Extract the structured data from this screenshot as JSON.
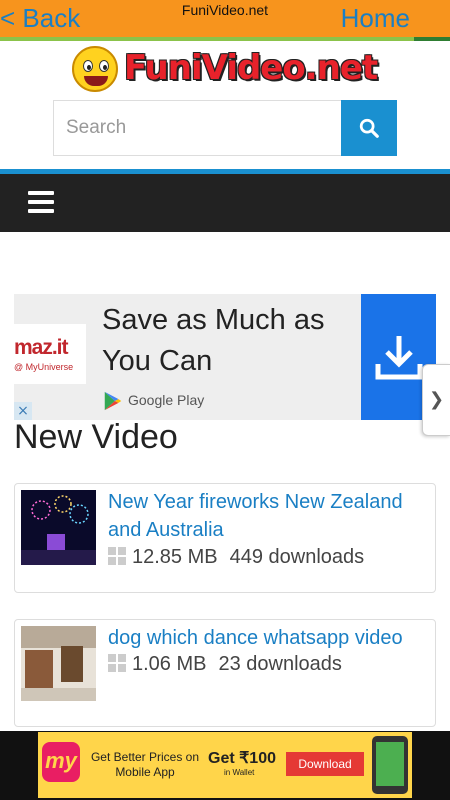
{
  "topbar": {
    "back_label": "< Back",
    "site_name": "FuniVideo.net",
    "home_label": "Home",
    "load_progress": 0.92
  },
  "logo": {
    "text": "FuniVideo.net"
  },
  "search": {
    "placeholder": "Search",
    "value": ""
  },
  "ad": {
    "brand_logo_text": "maz.it",
    "brand_sub_text": "@ MyUniverse",
    "headline": "Save as Much as You Can",
    "store_label": "Google Play",
    "close_label": "×"
  },
  "sidetab": {
    "label": "❯"
  },
  "section": {
    "title": "New Video"
  },
  "videos": [
    {
      "title": "New Year fireworks New Zealand and Australia",
      "size": "12.85 MB",
      "downloads": "449 downloads"
    },
    {
      "title": "dog which dance whatsapp video",
      "size": "1.06 MB",
      "downloads": "23 downloads"
    }
  ],
  "bottom_ad": {
    "logo_text": "my",
    "line1": "Get Better Prices on Mobile App",
    "offer": "Get ₹100",
    "offer_sub": "in Wallet",
    "button": "Download"
  },
  "colors": {
    "topbar": "#f7941d",
    "link": "#1a7fc4",
    "accent": "#1a90d0",
    "navbar": "#222222"
  }
}
